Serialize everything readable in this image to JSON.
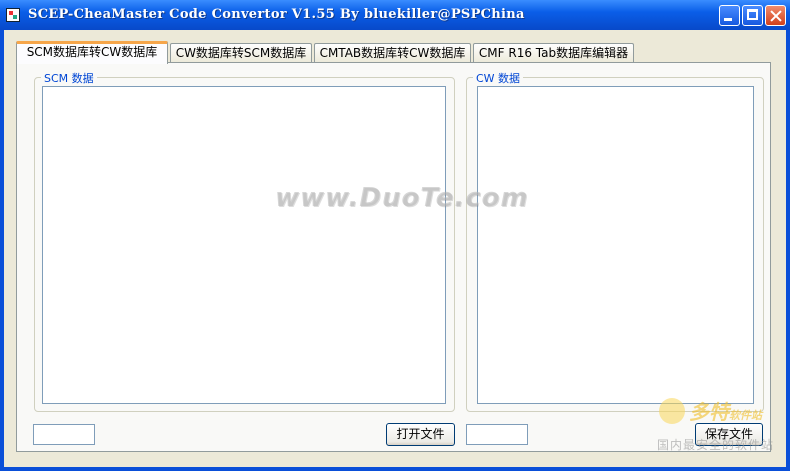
{
  "window": {
    "title": "SCEP-CheaMaster Code Convertor V1.55 By bluekiller@PSPChina",
    "controls": {
      "minimize": "minimize-icon",
      "maximize": "maximize-icon",
      "close": "close-icon"
    }
  },
  "tabs": [
    {
      "label": "SCM数据库转CW数据库",
      "active": true
    },
    {
      "label": "CW数据库转SCM数据库",
      "active": false
    },
    {
      "label": "CMTAB数据库转CW数据库",
      "active": false
    },
    {
      "label": "CMF R16 Tab数据库编辑器",
      "active": false
    }
  ],
  "panel": {
    "scm_group_label": "SCM 数据",
    "cw_group_label": "CW 数据",
    "scm_textarea_value": "",
    "cw_textarea_value": "",
    "left_textbox_value": "",
    "right_textbox_value": "",
    "open_file_button": "打开文件",
    "save_file_button": "保存文件"
  },
  "watermarks": {
    "center": "www.DuoTe.com",
    "logo_brand": "多特",
    "logo_brand_suffix": "软件站",
    "logo_slogan": "国内最安全的软件站"
  },
  "colors": {
    "titlebar": "#0a5ee8",
    "client_bg": "#ece9d8",
    "group_label": "#0046d5",
    "active_tab_accent": "#f6a64a"
  }
}
